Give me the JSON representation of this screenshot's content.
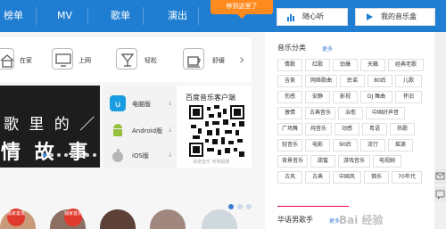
{
  "nav": {
    "items": [
      "榜单",
      "MV",
      "歌单",
      "演出"
    ],
    "tooltip": "移到这里了",
    "listen_label": "随心听",
    "box_label": "我的音乐盒"
  },
  "scenes": [
    {
      "label": "在家",
      "icon": "home-icon"
    },
    {
      "label": "上网",
      "icon": "monitor-icon"
    },
    {
      "label": "轻松",
      "icon": "drink-icon"
    },
    {
      "label": "舒缓",
      "icon": "coffee-cup-icon"
    }
  ],
  "banner": {
    "line1": "歌 里 的 ／",
    "line2": "情 故 事"
  },
  "client": {
    "title": "百度音乐客户端",
    "downloads": [
      {
        "label": "电脑版",
        "icon": "pc-app-icon"
      },
      {
        "label": "Android版",
        "icon": "android-icon"
      },
      {
        "label": "iOS版",
        "icon": "apple-icon"
      }
    ],
    "caption": "百度音乐 听到极致"
  },
  "categories": {
    "title": "音乐分类",
    "more": "更多",
    "rows": [
      [
        "情歌",
        "红歌",
        "劲爆",
        "天籁",
        "经典老歌"
      ],
      [
        "吉美",
        "网络歌曲",
        "民谣",
        "80后",
        "儿歌"
      ],
      [
        "伤感",
        "安静",
        "影视",
        "DJ 舞曲",
        "怀旧"
      ],
      [
        "激情",
        "古典音乐",
        "治愈",
        "中国好声音"
      ],
      [
        "广场舞",
        "纯音乐",
        "动感",
        "粤语",
        "热歌"
      ],
      [
        "轻音乐",
        "电影",
        "90后",
        "流行",
        "摇滚"
      ],
      [
        "背景音乐",
        "甜蜜",
        "游戏音乐",
        "电视剧"
      ],
      [
        "古风",
        "古典",
        "中国风",
        "佛乐",
        "70年代"
      ]
    ]
  },
  "singers": {
    "title": "华语男歌手",
    "more": "更多"
  },
  "badges": [
    "独家首发",
    "独家首发"
  ],
  "watermark": "Bai 经验",
  "colors": {
    "nav": "#1f7ed2",
    "tooltip": "#ff8a1e",
    "link": "#3c7cd6",
    "badge": "#e03a2e"
  }
}
